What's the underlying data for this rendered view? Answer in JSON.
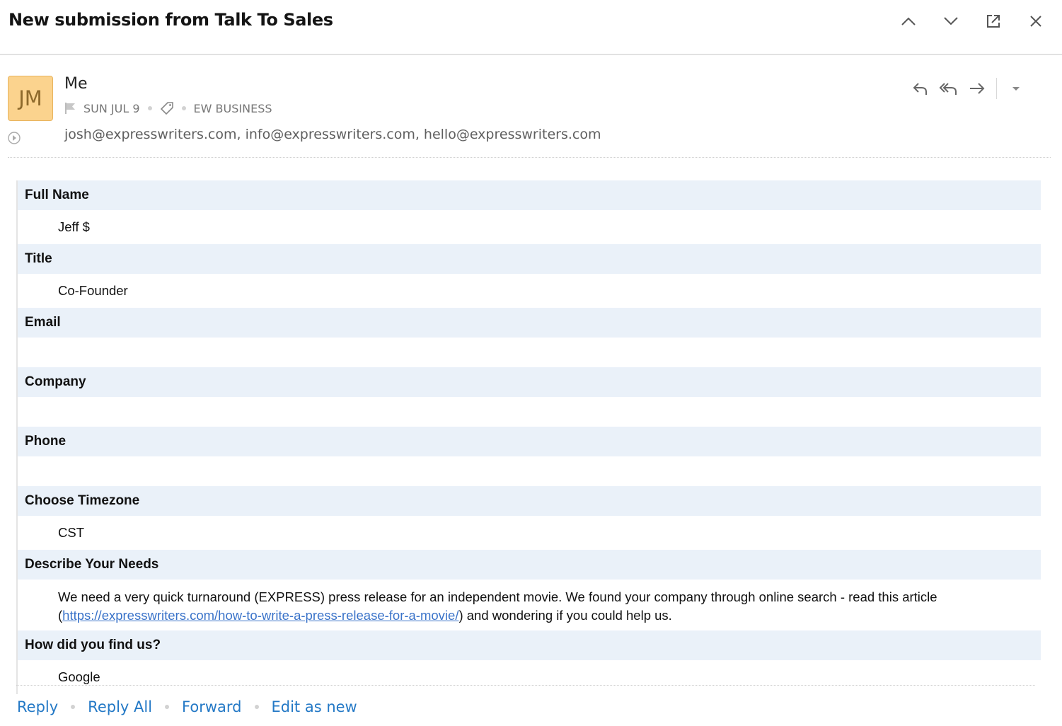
{
  "header": {
    "subject": "New submission from Talk To Sales",
    "icons": [
      "chevron-up-icon",
      "chevron-down-icon",
      "pop-out-icon",
      "close-icon"
    ]
  },
  "message": {
    "avatar_initials": "JM",
    "avatar_color": "#fbd38e",
    "sender": "Me",
    "date": "SUN JUL 9",
    "folder": "EW BUSINESS",
    "recipients": "josh@expresswriters.com, info@expresswriters.com, hello@expresswriters.com",
    "actions": [
      "reply-icon",
      "reply-all-icon",
      "forward-icon",
      "more-dropdown-icon"
    ]
  },
  "form": {
    "fields": [
      {
        "label": "Full Name",
        "value": "Jeff $"
      },
      {
        "label": "Title",
        "value": "Co-Founder"
      },
      {
        "label": "Email",
        "value": ""
      },
      {
        "label": "Company",
        "value": ""
      },
      {
        "label": "Phone",
        "value": ""
      },
      {
        "label": "Choose Timezone",
        "value": "CST"
      },
      {
        "label": "Describe Your Needs",
        "value_before": "We need a very quick turnaround (EXPRESS) press release for an independent movie. We found your company through online search - read this article (",
        "link": "https://expresswriters.com/how-to-write-a-press-release-for-a-movie/",
        "value_after": ") and wondering if you could help us."
      },
      {
        "label": "How did you find us?",
        "value": "Google"
      }
    ]
  },
  "footer": {
    "reply": "Reply",
    "reply_all": "Reply All",
    "forward": "Forward",
    "edit_as_new": "Edit as new"
  },
  "colors": {
    "accent": "#2479c6",
    "label_bg": "#eaf1f9",
    "link": "#3a73c9"
  }
}
